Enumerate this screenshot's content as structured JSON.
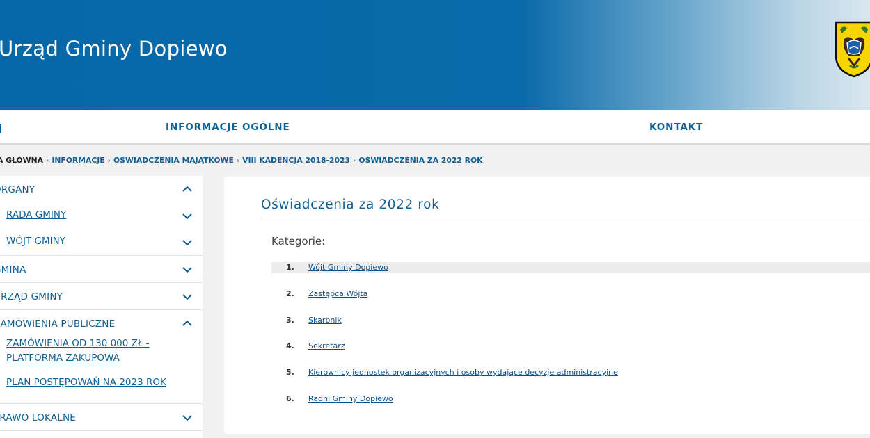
{
  "header": {
    "title": "Urząd Gminy Dopiewo"
  },
  "nav": {
    "items": [
      {
        "label": "INFORMACJE OGÓLNE"
      },
      {
        "label": "KONTAKT"
      }
    ]
  },
  "breadcrumb": {
    "items": [
      "STRONA GŁÓWNA",
      "INFORMACJE",
      "OŚWIADCZENIA MAJĄTKOWE",
      "VIII KADENCJA 2018-2023"
    ],
    "current": "OŚWIADCZENIA ZA 2022 ROK"
  },
  "sidebar": {
    "groups": [
      {
        "label": "ORGANY",
        "expanded": true,
        "children": [
          {
            "label": "RADA GMINY"
          },
          {
            "label": "WÓJT GMINY"
          }
        ]
      },
      {
        "label": "GMINA",
        "expanded": false
      },
      {
        "label": "URZĄD GMINY",
        "expanded": false
      },
      {
        "label": "ZAMÓWIENIA PUBLICZNE",
        "expanded": true,
        "children": [
          {
            "label": "ZAMÓWIENIA OD 130 000 ZŁ -",
            "label2": "PLATFORMA ZAKUPOWA"
          },
          {
            "label": "PLAN POSTĘPOWAŃ NA 2023 ROK"
          }
        ]
      },
      {
        "label": "PRAWO LOKALNE",
        "expanded": false
      }
    ]
  },
  "content": {
    "title": "Oświadczenia za 2022 rok",
    "categories_label": "Kategorie:",
    "categories": [
      {
        "num": "1.",
        "label": "Wójt Gminy Dopiewo"
      },
      {
        "num": "2.",
        "label": "Zastępca Wójta"
      },
      {
        "num": "3.",
        "label": "Skarbnik"
      },
      {
        "num": "4.",
        "label": "Sekretarz"
      },
      {
        "num": "5.",
        "label": "Kierownicy jednostek organizacyjnych i osoby wydające decyzje administracyjne"
      },
      {
        "num": "6.",
        "label": "Radni Gminy Dopiewo"
      }
    ]
  },
  "colors": {
    "header_blue": "#0868a7",
    "link_blue": "#0f5f92",
    "crest_yellow": "#f6d500"
  },
  "icons": {
    "crest": "coat-of-arms-icon",
    "expand": "chevron-down-icon",
    "collapse": "chevron-up-icon",
    "separator": "chevron-right-icon"
  }
}
